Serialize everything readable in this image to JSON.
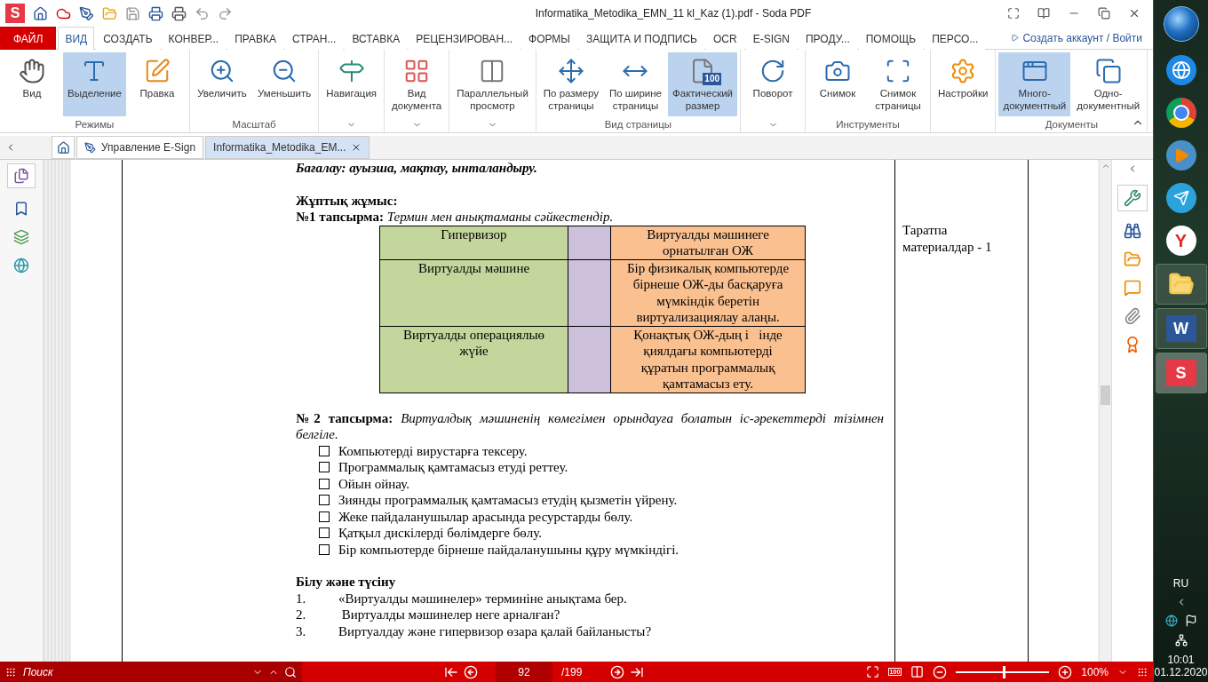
{
  "window": {
    "logo": "S",
    "title": "Informatika_Metodika_EMN_11 kl_Kaz (1).pdf - Soda PDF"
  },
  "menu_tabs": [
    {
      "label": "ФАЙЛ",
      "kind": "file",
      "selected": false
    },
    {
      "label": "ВИД",
      "kind": "tab",
      "selected": true
    },
    {
      "label": "СОЗДАТЬ",
      "kind": "tab",
      "selected": false
    },
    {
      "label": "КОНВЕР...",
      "kind": "tab",
      "selected": false
    },
    {
      "label": "ПРАВКА",
      "kind": "tab",
      "selected": false
    },
    {
      "label": "СТРАН...",
      "kind": "tab",
      "selected": false
    },
    {
      "label": "ВСТАВКА",
      "kind": "tab",
      "selected": false
    },
    {
      "label": "РЕЦЕНЗИРОВАН...",
      "kind": "tab",
      "selected": false
    },
    {
      "label": "ФОРМЫ",
      "kind": "tab",
      "selected": false
    },
    {
      "label": "ЗАЩИТА И ПОДПИСЬ",
      "kind": "tab",
      "selected": false
    },
    {
      "label": "OCR",
      "kind": "tab",
      "selected": false
    },
    {
      "label": "E-SIGN",
      "kind": "tab",
      "selected": false
    },
    {
      "label": "ПРОДУ...",
      "kind": "tab",
      "selected": false
    },
    {
      "label": "ПОМОЩЬ",
      "kind": "tab",
      "selected": false
    },
    {
      "label": "ПЕРСО...",
      "kind": "tab",
      "selected": false
    }
  ],
  "account_link": "Создать аккаунт / Войти",
  "ribbon_groups": [
    {
      "label": "Режимы",
      "dropdown": false,
      "buttons": [
        {
          "label": "Вид",
          "selected": false
        },
        {
          "label": "Выделение",
          "selected": true
        },
        {
          "label": "Правка",
          "selected": false
        }
      ]
    },
    {
      "label": "Масштаб",
      "dropdown": false,
      "buttons": [
        {
          "label": "Увеличить",
          "selected": false
        },
        {
          "label": "Уменьшить",
          "selected": false
        }
      ]
    },
    {
      "dropdown": true,
      "buttons": [
        {
          "label": "Навигация",
          "selected": false
        }
      ]
    },
    {
      "dropdown": true,
      "buttons": [
        {
          "label": "Вид\nдокумента",
          "selected": false
        }
      ]
    },
    {
      "dropdown": true,
      "buttons": [
        {
          "label": "Параллельный\nпросмотр",
          "selected": false
        }
      ]
    },
    {
      "label": "Вид страницы",
      "dropdown": false,
      "buttons": [
        {
          "label": "По размеру\nстраницы",
          "selected": false
        },
        {
          "label": "По ширине\nстраницы",
          "selected": false
        },
        {
          "label": "Фактический\nразмер",
          "selected": true,
          "badge": "100"
        }
      ]
    },
    {
      "dropdown": true,
      "buttons": [
        {
          "label": "Поворот",
          "selected": false
        }
      ]
    },
    {
      "label": "Инструменты",
      "dropdown": false,
      "buttons": [
        {
          "label": "Снимок",
          "selected": false
        },
        {
          "label": "Снимок\nстраницы",
          "selected": false
        }
      ]
    },
    {
      "dropdown": false,
      "buttons": [
        {
          "label": "Настройки",
          "selected": false
        }
      ]
    },
    {
      "label": "Документы",
      "dropdown": false,
      "buttons": [
        {
          "label": "Много-\nдокументный",
          "selected": true
        },
        {
          "label": "Одно-\nдокументный",
          "selected": false
        }
      ]
    }
  ],
  "doc_tabs": [
    {
      "label": "Управление E-Sign",
      "selected": false
    },
    {
      "label": "Informatika_Metodika_EM...",
      "selected": true
    }
  ],
  "document": {
    "assessment": "Бағалау: ауызша, мақтау, ынталандыру.",
    "pair_work": "Жұптық жұмыс:",
    "task1": "**№1 тапсырма:** *Термин мен анықтаманы сәйкестендір.*",
    "match_table": [
      {
        "term": "Гипервизор",
        "definition": "Виртуалды мәшинеге орнатылған ОЖ"
      },
      {
        "term": "Виртуалды мәшине",
        "definition": "Бір физикалық компьютерде бірнеше ОЖ-ды басқаруға мүмкіндік беретін виртуализациялау алаңы."
      },
      {
        "term": "Виртуалды операциялыө жүйе",
        "definition": "Қонақтық ОЖ-дың і   інде қиялдағы компьютерді құратын программалық қамтамасыз ету."
      }
    ],
    "task2": "**№2 тапсырма:** *Виртуалдық мәшиненің көмегімен орындауға болатын іс-әрекеттерді тізімнен белгіле.*",
    "checklist": [
      {
        "text": "Компьютерді вирустарға тексеру.",
        "checked": false
      },
      {
        "text": "Программалық қамтамасыз етуді реттеу.",
        "checked": false
      },
      {
        "text": "Ойын ойнау.",
        "checked": false
      },
      {
        "text": "Зиянды программалық қамтамасыз етудің қызметін үйрену.",
        "checked": false
      },
      {
        "text": "Жеке пайдаланушылар арасында ресурстарды бөлу.",
        "checked": false
      },
      {
        "text": "Қатқыл дискілерді бөлімдерге бөлу.",
        "checked": false
      },
      {
        "text": "Бір компьютерде бірнеше пайдаланушыны құру мүмкіндігі.",
        "checked": false
      }
    ],
    "knowledge_heading": "Білу және түсіну",
    "questions": [
      {
        "number": "1.",
        "text": "«Виртуалды мәшинелер» терминіне анықтама бер."
      },
      {
        "number": "2.",
        "text": " Виртуалды мәшинелер неге арналған?"
      },
      {
        "number": "3.",
        "text": "Виртуалдау және гипервизор өзара қалай байланысты?"
      }
    ],
    "side_note": "Таратпа материалдар -  1"
  },
  "status_bar": {
    "search_placeholder": "Поиск",
    "page": "92",
    "total": "/199",
    "fit_badge": "100",
    "zoom": {
      "level": 0.5,
      "reading": "100%"
    }
  },
  "taskbar": {
    "letter_tiles": [
      "Y",
      "W",
      "S"
    ],
    "language": "RU",
    "time": "10:01",
    "date": "01.12.2020"
  }
}
